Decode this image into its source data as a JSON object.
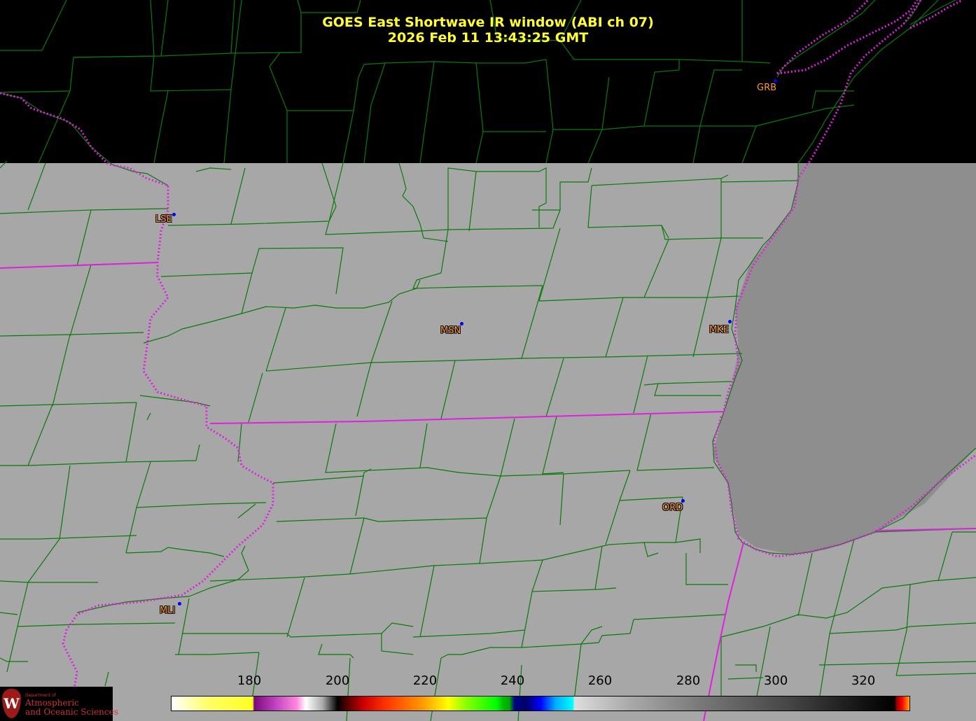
{
  "title": {
    "line1": "GOES East Shortwave IR window (ABI ch 07)",
    "line2": "2026 Feb 11  13:43:25 GMT"
  },
  "stations": [
    {
      "id": "grb",
      "label": "GRB"
    },
    {
      "id": "lse",
      "label": "LSE"
    },
    {
      "id": "msn",
      "label": "MSN"
    },
    {
      "id": "mke",
      "label": "MKE"
    },
    {
      "id": "ord",
      "label": "ORD"
    },
    {
      "id": "mli",
      "label": "MLI"
    }
  ],
  "colorbar": {
    "ticks": [
      "180",
      "200",
      "220",
      "240",
      "260",
      "280",
      "300",
      "320"
    ],
    "min": 163,
    "max": 330
  },
  "logo": {
    "small_text": "Department of",
    "line1": "Atmospheric",
    "line2": "and Oceanic Sciences",
    "shield_letter": "W"
  },
  "colors": {
    "title": "#ffff33",
    "station_label": "#ff9a2e",
    "station_dot": "#0000ff",
    "county_lines": "#0a7a0a",
    "state_lines": "#e020e0",
    "land": "#a7a7a7",
    "lake": "#8e8e8e",
    "no_data": "#000000"
  }
}
